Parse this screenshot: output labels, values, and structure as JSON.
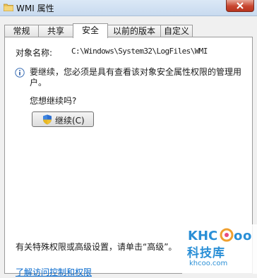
{
  "window": {
    "title": "WMI 属性",
    "close_icon": "close-icon",
    "folder_icon": "folder-icon"
  },
  "tabs": [
    {
      "label": "常规"
    },
    {
      "label": "共享"
    },
    {
      "label": "安全",
      "active": true
    },
    {
      "label": "以前的版本"
    },
    {
      "label": "自定义"
    }
  ],
  "security": {
    "object_name_label": "对象名称:",
    "object_name_value": "C:\\Windows\\System32\\LogFiles\\WMI",
    "message": "要继续，您必须是具有查看该对象安全属性权限的管理用户。",
    "question": "您想继续吗?",
    "continue_button": "继续(C)",
    "advanced_text": "有关特殊权限或高级设置，请单击“高级”。",
    "help_link": "了解访问控制和权限"
  },
  "watermark": {
    "logo_text": "KHCoo",
    "brand": "科技库",
    "url": "khcoo.com"
  },
  "colors": {
    "titlebar": "#c8daef",
    "close": "#c7452f",
    "link": "#0066cc"
  }
}
